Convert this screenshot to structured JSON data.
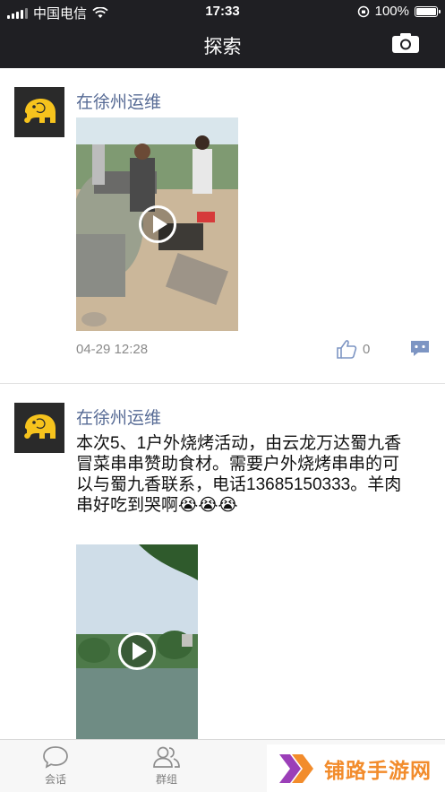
{
  "status": {
    "carrier": "中国电信",
    "time": "17:33",
    "battery": "100%",
    "battery_level": 1.0
  },
  "nav": {
    "title": "探索",
    "camera_icon": "camera-icon"
  },
  "posts": [
    {
      "user": "在徐州运维",
      "media_type": "video",
      "timestamp": "04-29 12:28",
      "likes": "0"
    },
    {
      "user": "在徐州运维",
      "text": "本次5、1户外烧烤活动，由云龙万达蜀九香冒菜串串赞助食材。需要户外烧烤串串的可以与蜀九香联系，电话13685150333。羊肉串好吃到哭啊😭😭😭",
      "media_type": "video"
    }
  ],
  "tabs": [
    {
      "label": "会话",
      "icon": "chat-bubble-icon"
    },
    {
      "label": "群组",
      "icon": "group-icon"
    }
  ],
  "watermark": {
    "text": "铺路手游网",
    "accent": "#f28c2c"
  },
  "colors": {
    "bar": "#1f1f23",
    "link": "#576b95",
    "accent": "#f28c2c"
  }
}
